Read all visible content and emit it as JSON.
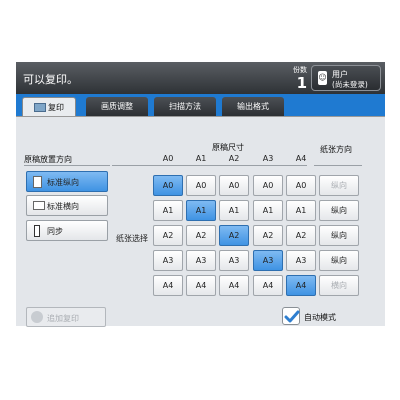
{
  "header": {
    "message": "可以复印。",
    "copies_label": "份数",
    "copies_value": "1",
    "user_label": "用户",
    "user_status": "(尚未登录)"
  },
  "tabs": [
    {
      "label": "复印",
      "active": true
    },
    {
      "label": "画质调整",
      "active": false
    },
    {
      "label": "扫描方法",
      "active": false
    },
    {
      "label": "输出格式",
      "active": false
    }
  ],
  "orientation": {
    "title": "原稿放置方向",
    "options": [
      {
        "label": "标准纵向",
        "selected": true,
        "icon": "portrait-page-icon"
      },
      {
        "label": "标准横向",
        "selected": false,
        "icon": "landscape-page-icon"
      },
      {
        "label": "同步",
        "selected": false,
        "icon": "sync-icon"
      }
    ]
  },
  "size_grid": {
    "title": "原稿尺寸",
    "row_title": "纸张选择",
    "columns": [
      "A0",
      "A1",
      "A2",
      "A3",
      "A4"
    ],
    "rows": [
      {
        "label": "A0",
        "cells": [
          "A0",
          "A0",
          "A0",
          "A0",
          "A0"
        ],
        "selected_col": 0
      },
      {
        "label": "A1",
        "cells": [
          "A1",
          "A1",
          "A1",
          "A1",
          "A1"
        ],
        "selected_col": 1
      },
      {
        "label": "A2",
        "cells": [
          "A2",
          "A2",
          "A2",
          "A2",
          "A2"
        ],
        "selected_col": 2
      },
      {
        "label": "A3",
        "cells": [
          "A3",
          "A3",
          "A3",
          "A3",
          "A3"
        ],
        "selected_col": 3
      },
      {
        "label": "A4",
        "cells": [
          "A4",
          "A4",
          "A4",
          "A4",
          "A4"
        ],
        "selected_col": 4
      }
    ]
  },
  "paper_direction": {
    "title": "纸张方向",
    "buttons": [
      {
        "label": "纵向",
        "enabled": false
      },
      {
        "label": "纵向",
        "enabled": true
      },
      {
        "label": "纵向",
        "enabled": true
      },
      {
        "label": "纵向",
        "enabled": true
      },
      {
        "label": "横向",
        "enabled": false
      }
    ]
  },
  "footer": {
    "add_copy_label": "追加复印",
    "auto_mode_label": "自动模式"
  },
  "colors": {
    "selected": "#3f93e3",
    "tab_bar": "#1f7ad1",
    "topbar": "#2e3236"
  }
}
